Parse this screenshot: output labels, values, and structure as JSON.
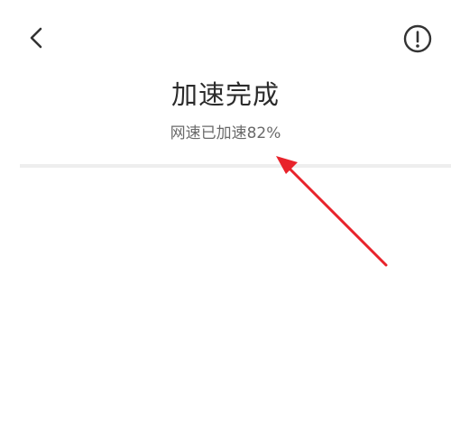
{
  "header": {
    "back_icon": "chevron-left-icon",
    "info_icon": "info-circle-icon"
  },
  "result": {
    "title": "加速完成",
    "subtitle": "网速已加速82%"
  },
  "annotation": {
    "color": "#e8232b"
  }
}
